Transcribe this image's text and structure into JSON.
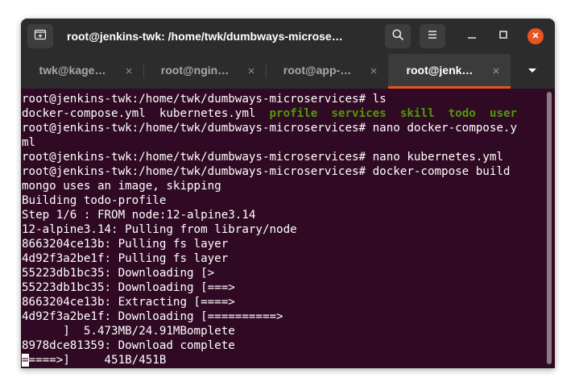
{
  "window": {
    "title": "root@jenkins-twk: /home/twk/dumbways-microse…",
    "colors": {
      "titlebar": "#2c2c2c",
      "terminal_bg": "#300a24",
      "accent": "#e95420",
      "directory": "#4e9a06"
    },
    "icons": {
      "new_tab": "new-tab-icon",
      "search": "search-icon",
      "menu": "hamburger-menu-icon",
      "minimize": "minimize-icon",
      "maximize": "maximize-icon",
      "close": "close-icon"
    }
  },
  "tabs": [
    {
      "label": "twk@kage…",
      "active": false
    },
    {
      "label": "root@ngin…",
      "active": false
    },
    {
      "label": "root@app-…",
      "active": false
    },
    {
      "label": "root@jenk…",
      "active": true
    }
  ],
  "terminal": {
    "lines": [
      "root@jenkins-twk:/home/twk/dumbways-microservices# ls",
      "docker-compose.yml  kubernetes.yml  ",
      "root@jenkins-twk:/home/twk/dumbways-microservices# nano docker-compose.y",
      "ml",
      "root@jenkins-twk:/home/twk/dumbways-microservices# nano kubernetes.yml",
      "root@jenkins-twk:/home/twk/dumbways-microservices# docker-compose build",
      "mongo uses an image, skipping",
      "Building todo-profile",
      "Step 1/6 : FROM node:12-alpine3.14",
      "12-alpine3.14: Pulling from library/node",
      "8663204ce13b: Pulling fs layer",
      "4d92f3a2be1f: Pulling fs layer",
      "55223db1bc35: Downloading [>",
      "55223db1bc35: Downloading [===>",
      "8663204ce13b: Extracting [====>",
      "4d92f3a2be1f: Downloading [==========>",
      "      ]  5.473MB/24.91MBomplete",
      "8978dce81359: Download complete",
      "====>]     451B/451B"
    ],
    "ls_dirs": [
      "profile",
      "services",
      "skill",
      "todo",
      "user"
    ],
    "cursor_char": "="
  }
}
